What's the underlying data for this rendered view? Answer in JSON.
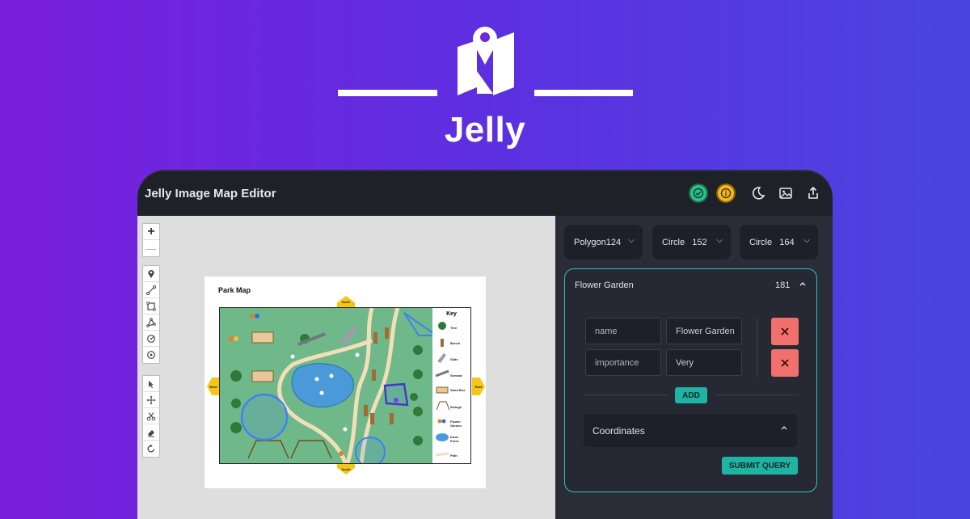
{
  "brand": {
    "name": "Jelly"
  },
  "app": {
    "title": "Jelly Image Map Editor"
  },
  "toolbar": {
    "status_ok_icon": "check-circle-icon",
    "status_info_icon": "info-circle-icon",
    "theme_icon": "moon-icon",
    "image_icon": "image-icon",
    "export_icon": "share-icon"
  },
  "zoom": {
    "in": "+",
    "out": "—"
  },
  "map": {
    "title": "Park Map",
    "key_title": "Key",
    "key_items": [
      "Tree",
      "Bench",
      "Slide",
      "Seesaw",
      "Sand Box",
      "Swings",
      "Flower Garden",
      "Duck Pond",
      "Path"
    ],
    "compass": {
      "north": "North",
      "south": "South",
      "east": "East",
      "west": "West"
    }
  },
  "shapes": [
    {
      "type": "Polygon",
      "id": "124"
    },
    {
      "type": "Circle",
      "id": "152"
    },
    {
      "type": "Circle",
      "id": "164"
    }
  ],
  "selected": {
    "name": "Flower Garden",
    "id": "181",
    "attributes": [
      {
        "key": "name",
        "value": "Flower Garden"
      },
      {
        "key": "importance",
        "value": "Very"
      }
    ],
    "add_label": "ADD",
    "coordinates_label": "Coordinates",
    "submit_label": "SUBMIT QUERY"
  },
  "colors": {
    "accent": "#1fb3a3",
    "danger": "#f0706c",
    "ok": "#2bbf8c",
    "warn": "#f1b823",
    "shape_stroke": "#3b82f6"
  }
}
